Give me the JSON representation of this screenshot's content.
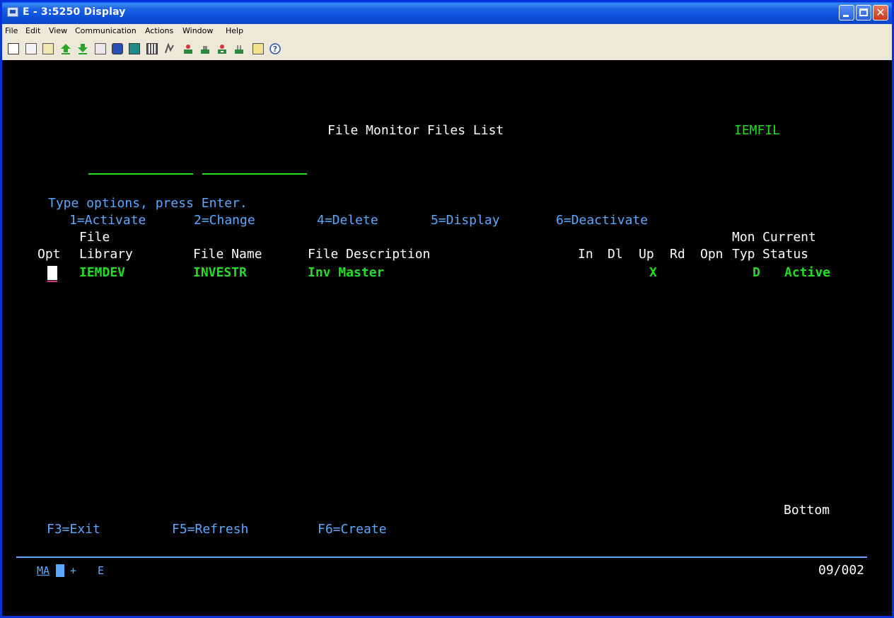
{
  "window": {
    "title": "E - 3:5250 Display"
  },
  "menubar": [
    "File",
    "Edit",
    "View",
    "Communication",
    "Actions",
    "Window",
    "Help"
  ],
  "toolbar_icons": [
    "copy-icon",
    "paste-icon",
    "paste-special-icon",
    "send-file-icon",
    "receive-file-icon",
    "macro-icon",
    "connect-icon",
    "display-icon",
    "keypad-icon",
    "edit-icon",
    "print-icon",
    "print-setup-icon",
    "trace-icon",
    "clear-icon",
    "notes-icon",
    "help-icon"
  ],
  "screen": {
    "title": "File Monitor Files List",
    "program": "IEMFIL",
    "instructions": "Type options, press Enter.",
    "options": [
      "1=Activate",
      "2=Change",
      "4=Delete",
      "5=Display",
      "6=Deactivate"
    ],
    "headers": {
      "file_upper": "File",
      "mon_upper": "Mon",
      "current_upper": "Current",
      "opt": "Opt",
      "library": "Library",
      "file_name": "File Name",
      "file_description": "File Description",
      "in": "In",
      "dl": "Dl",
      "up": "Up",
      "rd": "Rd",
      "opn": "Opn",
      "typ": "Typ",
      "status": "Status"
    },
    "rows": [
      {
        "library": "IEMDEV",
        "file_name": "INVESTR",
        "description": "Inv Master",
        "up": "X",
        "typ": "D",
        "status": "Active"
      }
    ],
    "more_indicator": "Bottom",
    "function_keys": [
      "F3=Exit",
      "F5=Refresh",
      "F6=Create"
    ],
    "status": {
      "ma": "MA",
      "ind": "+",
      "e": "E",
      "cursor_pos": "09/002"
    }
  }
}
